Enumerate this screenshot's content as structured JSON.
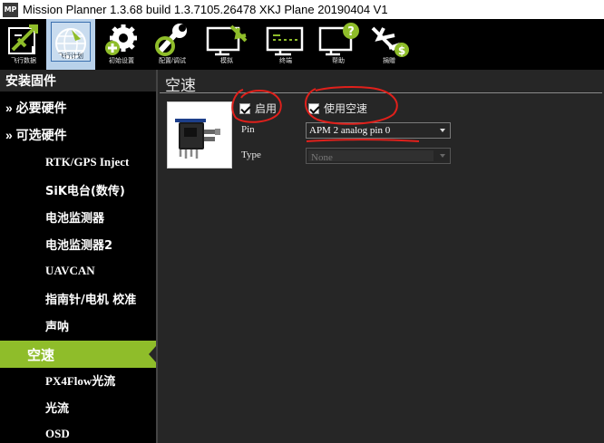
{
  "window": {
    "title": "Mission Planner 1.3.68 build 1.3.7105.26478 XKJ Plane 20190404 V1",
    "logo_text": "MP"
  },
  "toolbar": {
    "buttons": [
      {
        "label": "飞行数据",
        "icon": "airplane-flight-data-icon"
      },
      {
        "label": "飞行计划",
        "icon": "globe-flight-plan-icon"
      },
      {
        "label": "初始设置",
        "icon": "gear-initial-setup-icon"
      },
      {
        "label": "配置/调试",
        "icon": "wrench-config-tuning-icon"
      },
      {
        "label": "模拟",
        "icon": "simulation-icon"
      },
      {
        "label": "终端",
        "icon": "terminal-icon"
      },
      {
        "label": "帮助",
        "icon": "help-icon"
      },
      {
        "label": "捐赠",
        "icon": "donate-icon"
      }
    ]
  },
  "sidebar": {
    "header": "安装固件",
    "groups": [
      {
        "label": "» 必要硬件"
      },
      {
        "label": "» 可选硬件"
      }
    ],
    "items": [
      {
        "label": "RTK/GPS Inject"
      },
      {
        "label": "SiK电台(数传)"
      },
      {
        "label": "电池监测器"
      },
      {
        "label": "电池监测器2"
      },
      {
        "label": "UAVCAN"
      },
      {
        "label": "指南针/电机 校准"
      },
      {
        "label": "声呐"
      },
      {
        "label": "空速"
      },
      {
        "label": "PX4Flow光流"
      },
      {
        "label": "光流"
      },
      {
        "label": "OSD"
      }
    ],
    "active_index": 7
  },
  "main": {
    "title": "空速",
    "enable_checkbox": {
      "label": "启用",
      "checked": true
    },
    "use_airspeed_checkbox": {
      "label": "使用空速",
      "checked": true
    },
    "pin": {
      "label": "Pin",
      "value": "APM 2 analog pin 0"
    },
    "type": {
      "label": "Type",
      "value": "None",
      "enabled": false
    }
  },
  "colors": {
    "active_item": "#8fbd2a",
    "background": "#262626",
    "annotation": "#e0201b"
  }
}
